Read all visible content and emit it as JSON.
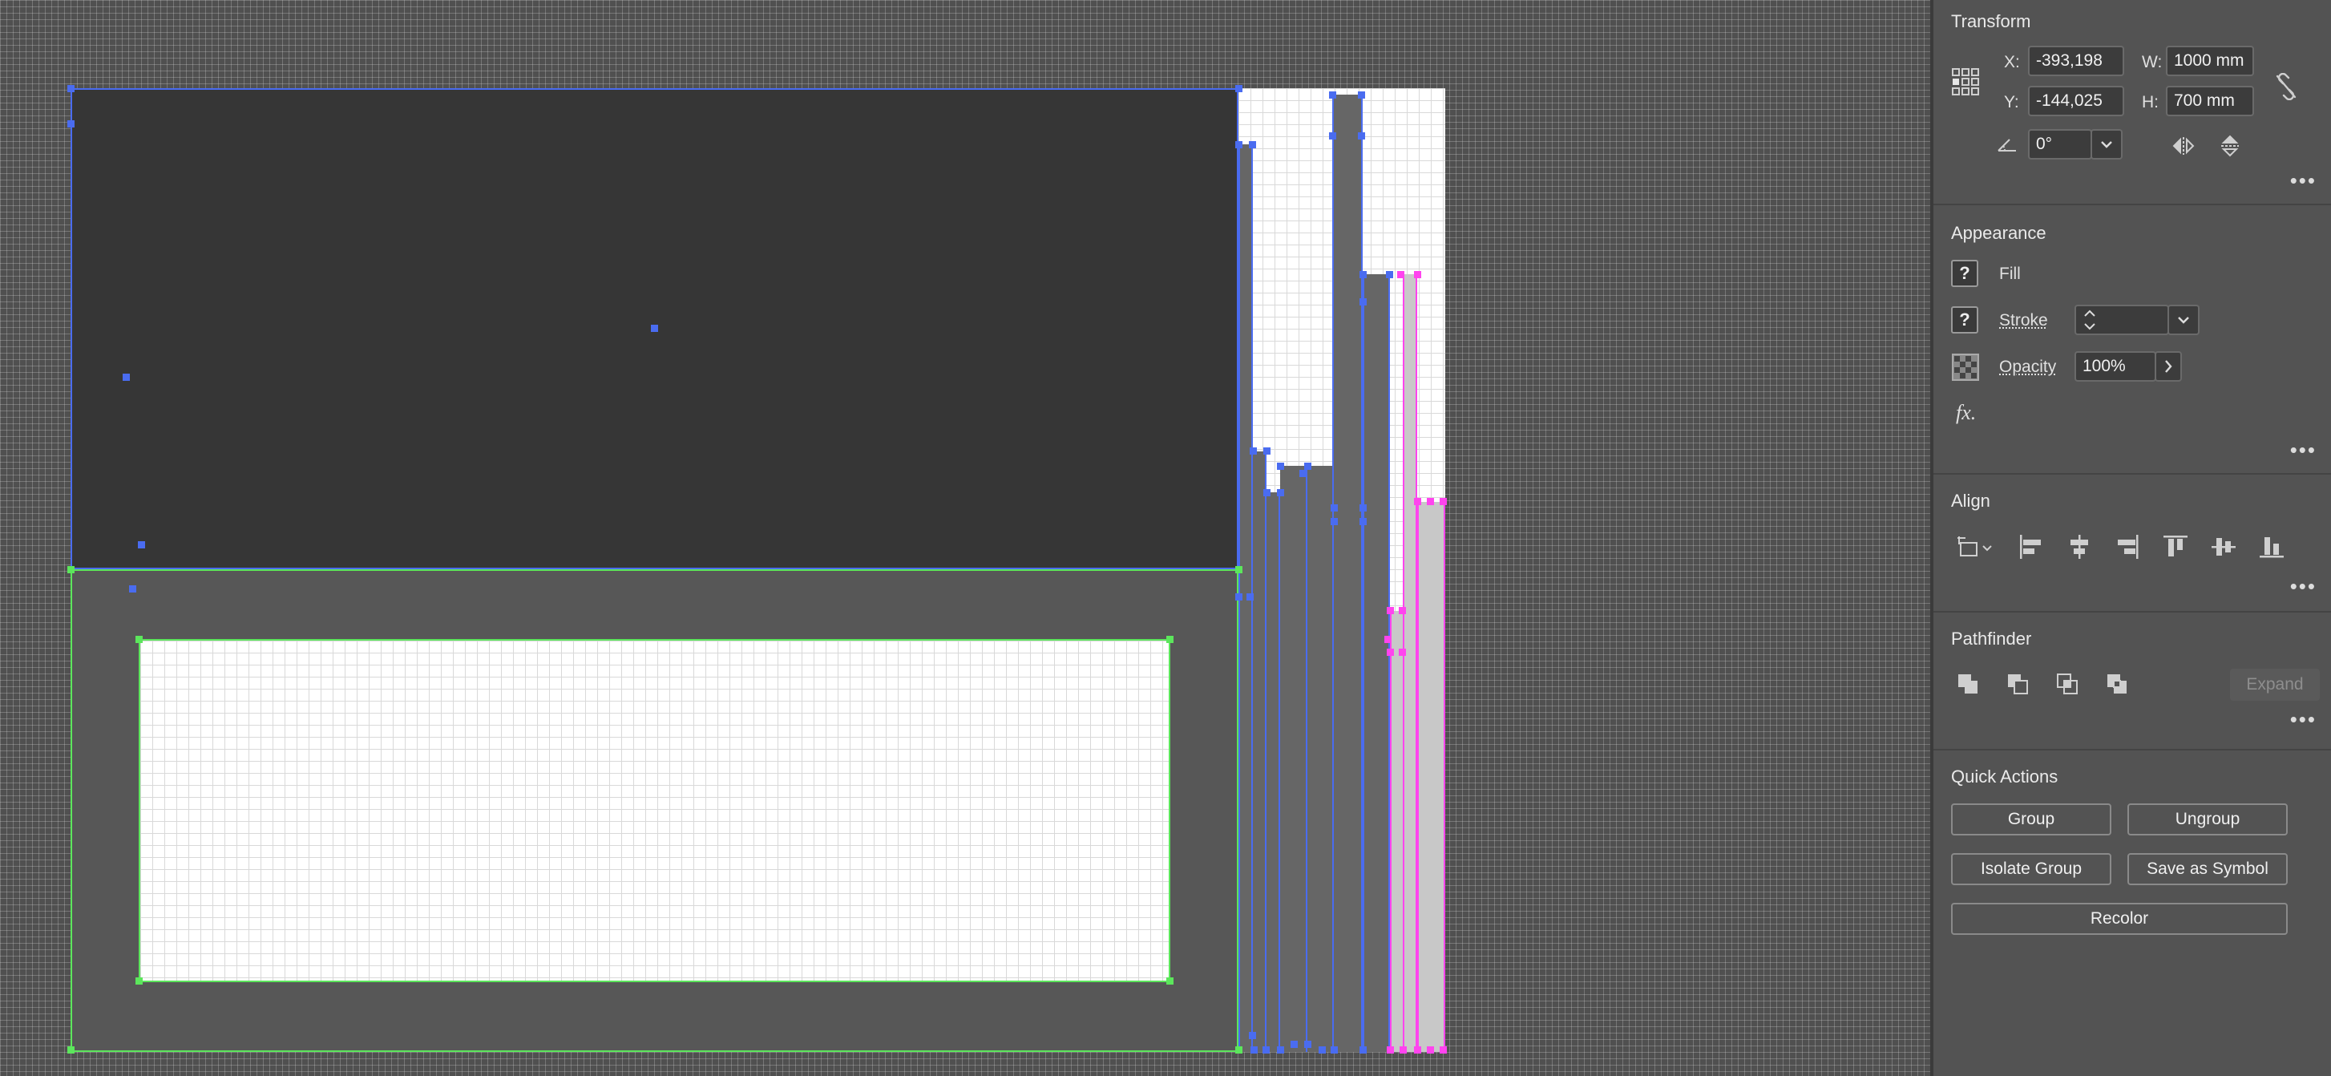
{
  "transform": {
    "title": "Transform",
    "x_label": "X:",
    "x_value": "-393,198",
    "y_label": "Y:",
    "y_value": "-144,025",
    "w_label": "W:",
    "w_value": "1000 mm",
    "h_label": "H:",
    "h_value": "700 mm",
    "angle_value": "0°",
    "more": "•••"
  },
  "appearance": {
    "title": "Appearance",
    "fill_label": "Fill",
    "stroke_label": "Stroke",
    "opacity_label": "Opacity",
    "opacity_value": "100%",
    "unknown_swatch": "?",
    "fx_label": "fx.",
    "more": "•••"
  },
  "align": {
    "title": "Align",
    "more": "•••"
  },
  "pathfinder": {
    "title": "Pathfinder",
    "expand_label": "Expand",
    "more": "•••"
  },
  "quick_actions": {
    "title": "Quick Actions",
    "group": "Group",
    "ungroup": "Ungroup",
    "isolate_group": "Isolate Group",
    "save_as_symbol": "Save as Symbol",
    "recolor": "Recolor"
  },
  "colors": {
    "selection_blue": "#4a6cf0",
    "selection_green": "#5ce65c",
    "selection_magenta": "#ff44ee",
    "panel_bg": "#535353",
    "canvas_bg": "#505050"
  }
}
